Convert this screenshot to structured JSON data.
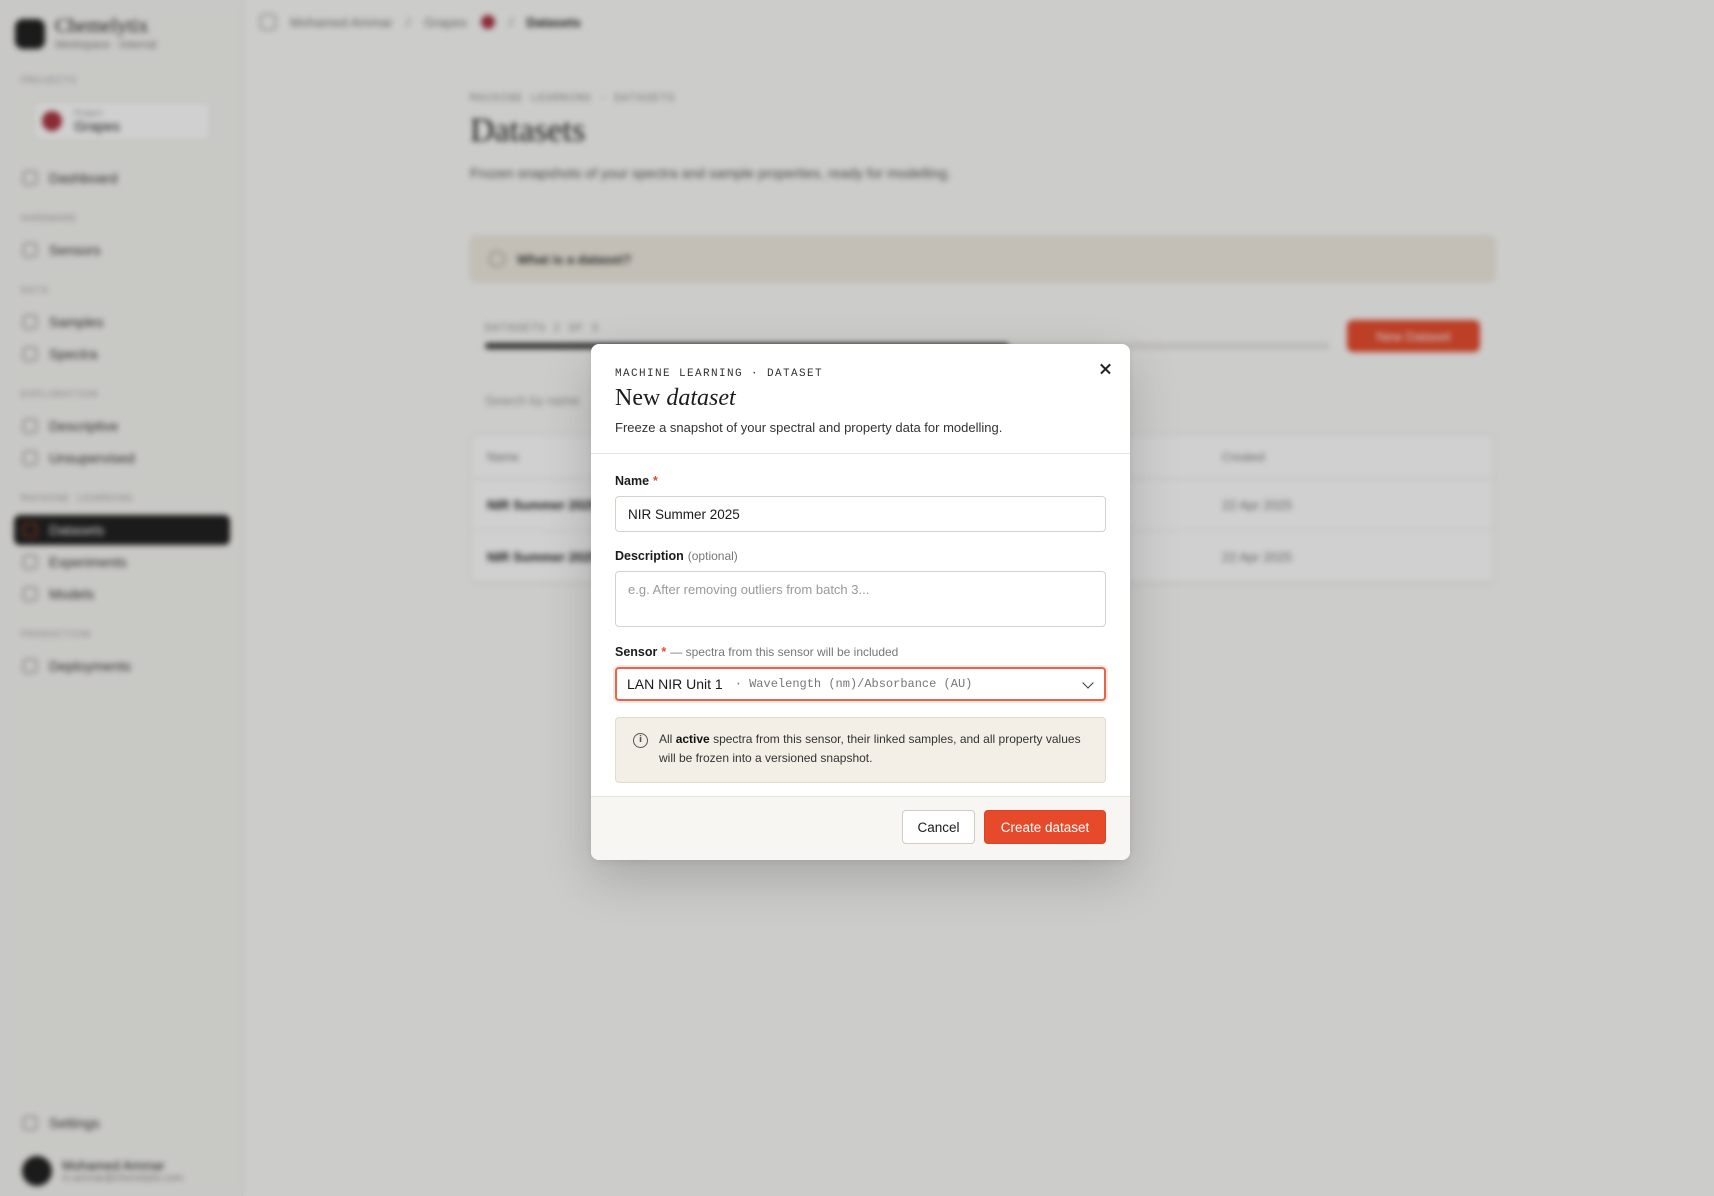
{
  "sidebar": {
    "brand": {
      "name": "Chemelytix",
      "sub": "Workspace · Internal"
    },
    "projects_label": "Projects",
    "project": {
      "label": "Project",
      "name": "Grapes"
    },
    "items": [
      {
        "label": "Dashboard"
      },
      {
        "section": "Hardware"
      },
      {
        "label": "Sensors"
      },
      {
        "section": "Data"
      },
      {
        "label": "Samples"
      },
      {
        "label": "Spectra"
      },
      {
        "section": "Exploration"
      },
      {
        "label": "Descriptive"
      },
      {
        "label": "Unsupervised"
      },
      {
        "section": "Machine learning"
      },
      {
        "label": "Datasets"
      },
      {
        "label": "Experiments"
      },
      {
        "label": "Models"
      },
      {
        "section": "Production"
      },
      {
        "label": "Deployments"
      }
    ],
    "settings": "Settings",
    "user": {
      "name": "Mohamed Ammar",
      "email": "m.ammar@chemelytix.com"
    }
  },
  "topbar": {
    "crumbs": [
      "Mohamed Ammar",
      "Grapes",
      "Datasets"
    ]
  },
  "page": {
    "kicker": "MACHINE LEARNING · DATASETS",
    "title": "Datasets",
    "description": "Frozen snapshots of your spectra and sample properties, ready for modelling.",
    "banner": "What is a dataset?",
    "counter": "DATASETS 2 OF 3",
    "counter_fraction": 0.62,
    "new_button": "New Dataset",
    "search_placeholder": "Search by name",
    "table": {
      "headers": {
        "name": "Name",
        "created": "Created"
      },
      "rows": [
        {
          "name": "NIR Summer 2025",
          "created": "22 Apr 2025"
        },
        {
          "name": "NIR Summer 2025",
          "created": "22 Apr 2025"
        }
      ]
    }
  },
  "modal": {
    "kicker": "MACHINE LEARNING · DATASET",
    "title_plain": "New",
    "title_italic": "dataset",
    "description": "Freeze a snapshot of your spectral and property data for modelling.",
    "name_field": {
      "label": "Name",
      "required": "*",
      "value": "NIR Summer 2025"
    },
    "description_field": {
      "label": "Description",
      "hint": "(optional)",
      "placeholder": "e.g. After removing outliers from batch 3..."
    },
    "sensor_field": {
      "label": "Sensor",
      "required": "*",
      "hint": "— spectra from this sensor will be included",
      "value": "LAN NIR Unit 1",
      "meta": "· Wavelength (nm)/Absorbance (AU)"
    },
    "notice": {
      "prefix": "All",
      "bold": "active",
      "suffix": "spectra from this sensor, their linked samples, and all property values will be frozen into a versioned snapshot."
    },
    "cancel_label": "Cancel",
    "create_label": "Create dataset"
  }
}
